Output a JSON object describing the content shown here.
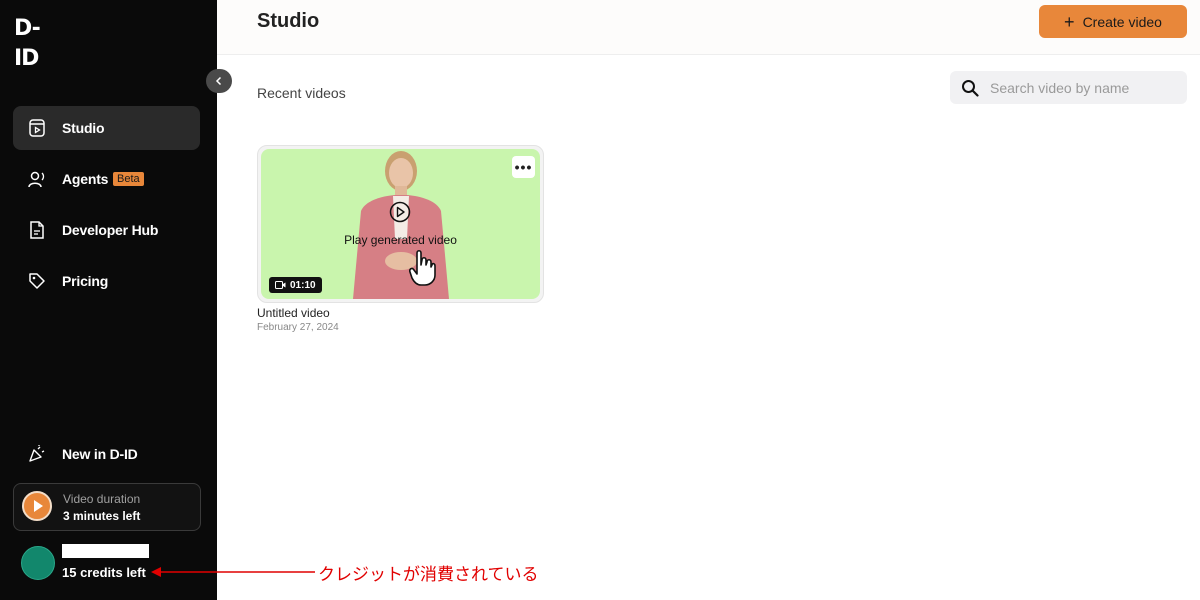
{
  "sidebar": {
    "logo": "D-ID",
    "items": [
      {
        "label": "Studio",
        "icon": "video-file-icon",
        "active": true
      },
      {
        "label": "Agents",
        "icon": "agent-icon",
        "badge": "Beta"
      },
      {
        "label": "Developer Hub",
        "icon": "document-icon"
      },
      {
        "label": "Pricing",
        "icon": "tag-icon"
      }
    ],
    "news_label": "New in D-ID",
    "duration": {
      "label": "Video duration",
      "value": "3 minutes left"
    },
    "credits": "15 credits left"
  },
  "header": {
    "title": "Studio",
    "create_label": "Create video"
  },
  "main": {
    "section_title": "Recent videos",
    "search_placeholder": "Search video by name",
    "videos": [
      {
        "title": "Untitled video",
        "date": "February 27, 2024",
        "duration": "01:10",
        "overlay": "Play generated video"
      }
    ]
  },
  "annotation": "クレジットが消費されている",
  "colors": {
    "accent": "#e8873a",
    "sidebar_bg": "#0a0a0a",
    "thumb_bg": "#c9f5ad",
    "annotation": "#e10000"
  }
}
